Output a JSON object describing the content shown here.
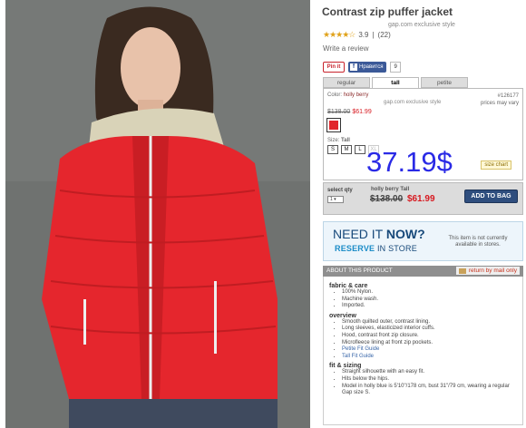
{
  "product": {
    "title": "Contrast zip puffer jacket",
    "exclusive": "gap.com exclusive style",
    "rating_stars": "★★★★☆",
    "rating_value": "3.9",
    "review_count": "(22)",
    "write_review": "Write a review"
  },
  "share": {
    "pin_label": "Pin it",
    "fb_label": "Нравится",
    "fb_count": "9"
  },
  "fit_tabs": [
    "regular",
    "tall",
    "petite"
  ],
  "variant": {
    "color_label": "Color:",
    "color_name": "holly berry",
    "sku": "#126177",
    "price_note": "prices may vary",
    "exclusive": "gap.com exclusive style",
    "was_price": "$138.00",
    "now_price": "$61.99",
    "swatch_color": "#e1252b",
    "size_label": "Size:",
    "size_value": "Tall",
    "sizes": [
      "S",
      "M",
      "L",
      "XL"
    ],
    "overlay_price": "37.19$",
    "size_chart": "size chart"
  },
  "bag": {
    "qty_label": "select qty",
    "qty_value": "1",
    "selection": "holly berry Tall",
    "was_price": "$138.00",
    "now_price": "$61.99",
    "button": "ADD TO BAG"
  },
  "banner": {
    "need_prefix": "NEED IT ",
    "need_bold": "NOW?",
    "reserve_bold": "RESERVE",
    "reserve_rest": " IN STORE",
    "note": "This item is not currently available in stores."
  },
  "about": {
    "header": "ABOUT THIS PRODUCT",
    "return": "return by mail only",
    "sections": [
      {
        "title": "fabric & care",
        "items": [
          "100% Nylon.",
          "Machine wash.",
          "Imported."
        ]
      },
      {
        "title": "overview",
        "items": [
          "Smooth quilted outer, contrast lining.",
          "Long sleeves, elasticized interior cuffs.",
          "Hood, contrast front zip closure.",
          "Microfleece lining at front zip pockets.",
          "Petite Fit Guide",
          "Tall Fit Guide"
        ]
      },
      {
        "title": "fit & sizing",
        "items": [
          "Straight silhouette with an easy fit.",
          "Hits below the hips.",
          "Model in holly blue is 5'10\"/178 cm, bust 31\"/79 cm, wearing a regular Gap size S."
        ]
      }
    ]
  },
  "colors": {
    "accent_red": "#d71920",
    "button_blue": "#2f4e7e",
    "overlay_blue": "#2a2ae6"
  }
}
